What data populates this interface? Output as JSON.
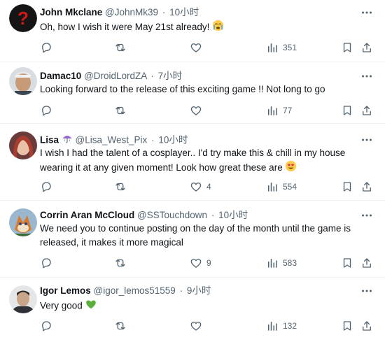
{
  "replies": [
    {
      "name": "John Mkclane",
      "handle": "@JohnMk39",
      "time": "10小时",
      "text": "Oh, how I wish it were May 21st already!",
      "emoji": "crying-face-emoji",
      "views": "351",
      "likes": ""
    },
    {
      "name": "Damac10",
      "handle": "@DroidLordZA",
      "time": "7小时",
      "text": "Looking forward to the release of this exciting game !! Not long to go",
      "views": "77",
      "likes": ""
    },
    {
      "name": "Lisa",
      "badge": "umbrella-emoji",
      "handle": "@Lisa_West_Pix",
      "time": "10小时",
      "text": "I wish I had the talent of a cosplayer.. I'd try make this & chill in my house wearing it at any given moment! Look how great these are",
      "emoji": "heart-eyes-emoji",
      "views": "554",
      "likes": "4"
    },
    {
      "name": "Corrin Aran McCloud",
      "handle": "@SSTouchdown",
      "time": "10小时",
      "text": "We need you to continue posting on the day of the month until the game is released, it makes it more magical",
      "views": "583",
      "likes": "9"
    },
    {
      "name": "Igor Lemos",
      "handle": "@igor_lemos51559",
      "time": "9小时",
      "text": "Very good",
      "emoji": "green-heart-emoji",
      "views": "132",
      "likes": ""
    }
  ],
  "separator": "·"
}
